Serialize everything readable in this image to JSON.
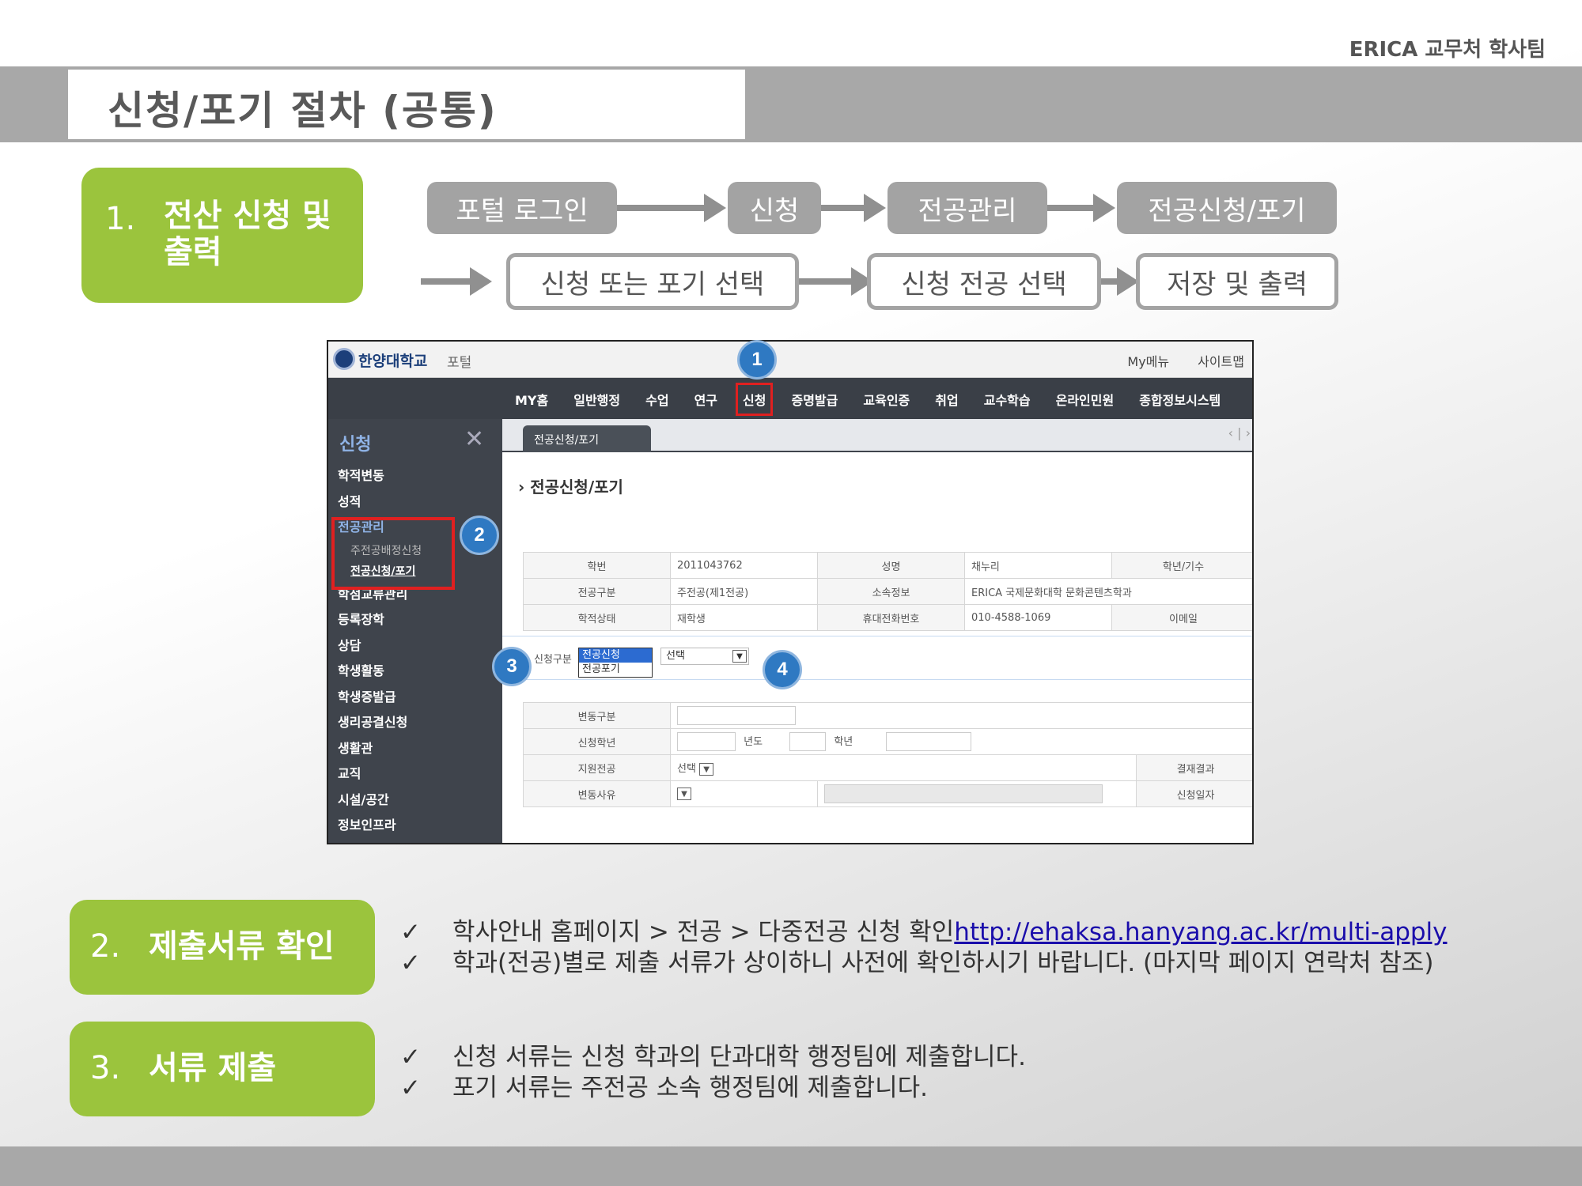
{
  "header": {
    "org": "ERICA 교무처 학사팀",
    "title": "신청/포기 절차 (공통)"
  },
  "steps": [
    {
      "num": "1.",
      "label_line1": "전산 신청 및",
      "label_line2": "출력"
    },
    {
      "num": "2.",
      "label": "제출서류 확인"
    },
    {
      "num": "3.",
      "label": "서류 제출"
    }
  ],
  "flow": {
    "row1": [
      "포털 로그인",
      "신청",
      "전공관리",
      "전공신청/포기"
    ],
    "row2": [
      "신청 또는 포기 선택",
      "신청 전공 선택",
      "저장 및 출력"
    ]
  },
  "screenshot": {
    "logo": "한양대학교",
    "portal": "포털",
    "top_links": [
      "My메뉴",
      "사이트맵"
    ],
    "menu": [
      "MY홈",
      "일반행정",
      "수업",
      "연구",
      "신청",
      "증명발급",
      "교육인증",
      "취업",
      "교수학습",
      "온라인민원",
      "종합정보시스템"
    ],
    "sidebar_title": "신청",
    "sidebar_close": "✕",
    "sidebar": {
      "before": [
        "학적변동",
        "성적"
      ],
      "group": "전공관리",
      "sub": [
        "주전공배정신청",
        "전공신청/포기"
      ],
      "after": [
        "학점교류관리",
        "등록장학",
        "상담",
        "학생활동",
        "학생증발급",
        "생리공결신청",
        "생활관",
        "교직",
        "시설/공간",
        "정보인프라"
      ]
    },
    "tab": "전공신청/포기",
    "tab_nav": "‹ | ›",
    "page_heading": "전공신청/포기",
    "info_table": [
      [
        "학번",
        "2011043762",
        "성명",
        "채누리",
        "학년/기수"
      ],
      [
        "전공구분",
        "주전공(제1전공)",
        "소속정보",
        "ERICA 국제문화대학 문화콘텐츠학과",
        ""
      ],
      [
        "학적상태",
        "재학생",
        "휴대전화번호",
        "010-4588-1069",
        "이메일"
      ]
    ],
    "apply_label": "신청구분",
    "apply_options": [
      "전공신청",
      "전공포기"
    ],
    "select_value": "선택",
    "form": {
      "change_type": "변동구분",
      "apply_grade": "신청학년",
      "year": "년도",
      "grade": "학년",
      "target_major": "지원전공",
      "target_select": "선택",
      "result": "결재결과",
      "reason": "변동사유",
      "apply_date": "신청일자"
    },
    "badges": [
      "1",
      "2",
      "3",
      "4"
    ]
  },
  "step2": {
    "bullets": [
      {
        "text": "학사안내 홈페이지  > 전공 > 다중전공 신청 확인 ",
        "link": "http://ehaksa.hanyang.ac.kr/multi-apply"
      },
      {
        "text": "학과(전공)별로 제출 서류가 상이하니 사전에 확인하시기 바랍니다. (마지막 페이지 연락처 참조)"
      }
    ]
  },
  "step3": {
    "bullets": [
      "신청 서류는 신청 학과의 단과대학 행정팀에 제출합니다.",
      "포기 서류는 주전공 소속 행정팀에 제출합니다."
    ]
  },
  "check_mark": "✓",
  "colors": {
    "green": "#9bc43d",
    "grey": "#a3a3a3",
    "badge": "#2f79c2",
    "highlight": "#e02020"
  }
}
